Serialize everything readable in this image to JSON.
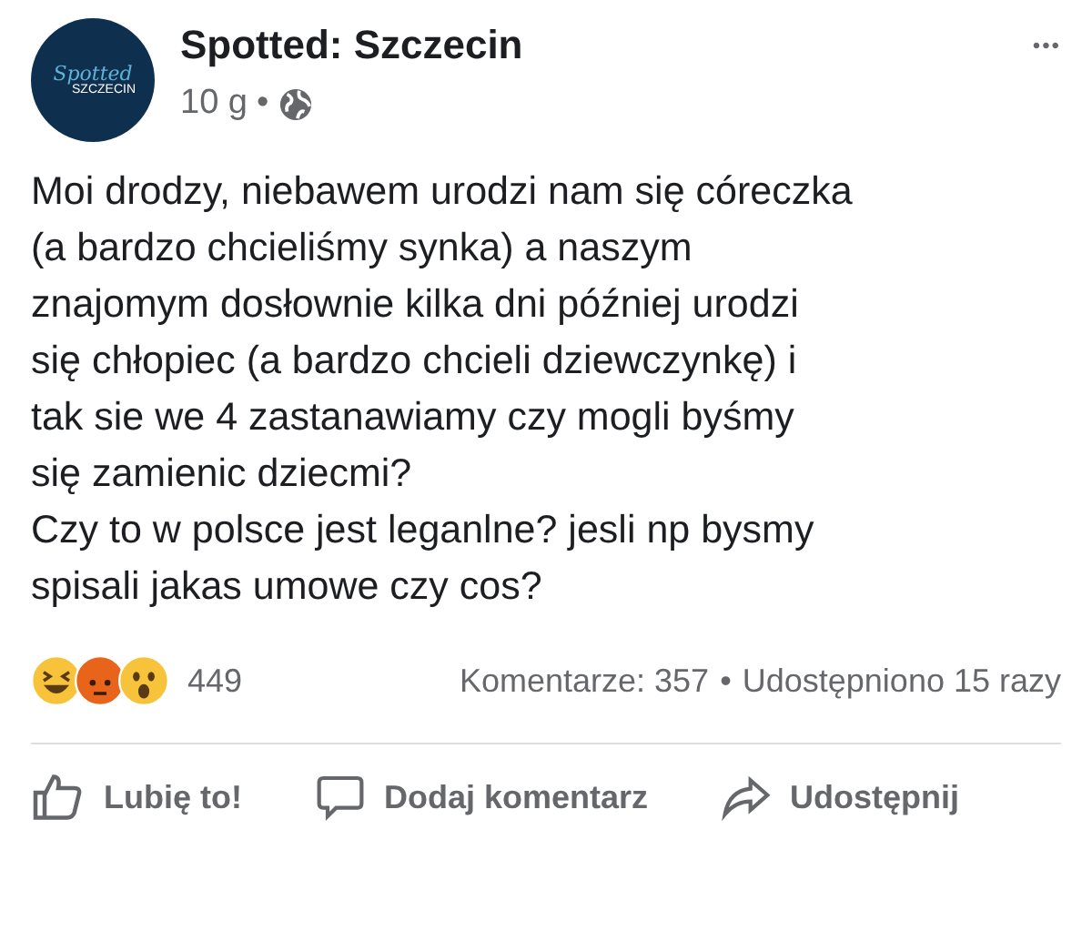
{
  "post": {
    "avatar_text": [
      "Spotted",
      "SZCZECIN"
    ],
    "author": "Spotted: Szczecin",
    "time": "10 g",
    "separator": "•",
    "menu": "•••",
    "paragraphs": [
      "Moi drodzy, niebawem urodzi nam się córeczka\n(a bardzo chcieliśmy synka) a naszym\nznajomym dosłownie kilka dni później urodzi\nsię chłopiec (a bardzo chcieli dziewczynkę) i\ntak sie we 4 zastanawiamy czy mogli byśmy\nsię zamienic dziecmi?",
      "Czy to w polsce jest leganlne? jesli np bysmy\nspisali jakas umowe czy cos?"
    ]
  },
  "stats": {
    "reactions": [
      {
        "kind": "haha"
      },
      {
        "kind": "angry"
      },
      {
        "kind": "wow"
      }
    ],
    "reaction_count": "449",
    "comments": "Komentarze: 357",
    "separator": "•",
    "shares": "Udostępniono 15 razy"
  },
  "actions": [
    {
      "kind": "like",
      "label": "Lubię to!"
    },
    {
      "kind": "comment",
      "label": "Dodaj komentarz"
    },
    {
      "kind": "share",
      "label": "Udostępnij"
    }
  ]
}
